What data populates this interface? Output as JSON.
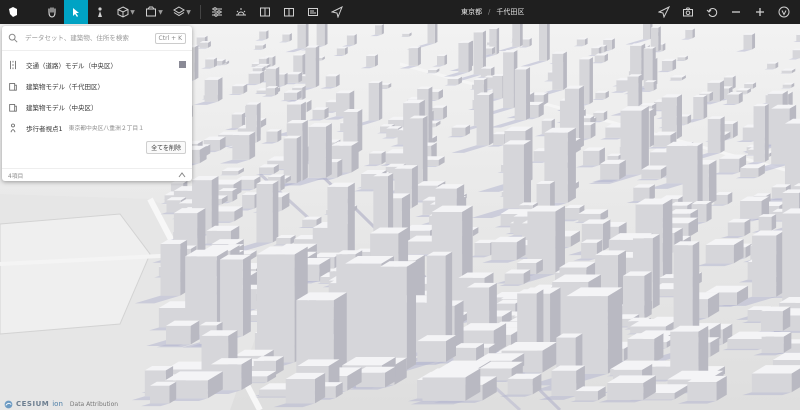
{
  "toolbar": {
    "left_icons": [
      "logo-icon",
      "hand-icon",
      "select-arrow-icon",
      "pedestrian-icon",
      "box-icon",
      "package-icon",
      "layers-icon"
    ],
    "right_icons": [
      "sliders-icon",
      "sun-horizon-icon",
      "columns-icon",
      "book-icon",
      "card-icon",
      "send-icon"
    ],
    "accent": "#00a3c4"
  },
  "breadcrumb": {
    "prefecture": "東京都",
    "separator": "/",
    "ward": "千代田区"
  },
  "right_tools": [
    "navigate-icon",
    "camera-icon",
    "undo-icon",
    "zoom-out-icon",
    "zoom-in-icon",
    "compass-icon"
  ],
  "panel": {
    "search_placeholder": "データセット、建築物、住所を検索",
    "shortcut": "Ctrl + K",
    "layers": [
      {
        "label": "交通（道路）モデル（中央区）",
        "icon": "road-icon",
        "sub": ""
      },
      {
        "label": "建築物モデル（千代田区）",
        "icon": "building-icon",
        "sub": ""
      },
      {
        "label": "建築物モデル（中央区）",
        "icon": "building-icon",
        "sub": ""
      },
      {
        "label": "歩行者視点1",
        "icon": "pedestrian-icon",
        "sub": "東京都中央区八重洲２丁目１"
      }
    ],
    "swatch_color": "#8a8a96",
    "clear_all": "全てを削除",
    "count": "4項目"
  },
  "credits": {
    "brand": "CESIUM",
    "ion": "ion",
    "attribution": "Data Attribution"
  }
}
